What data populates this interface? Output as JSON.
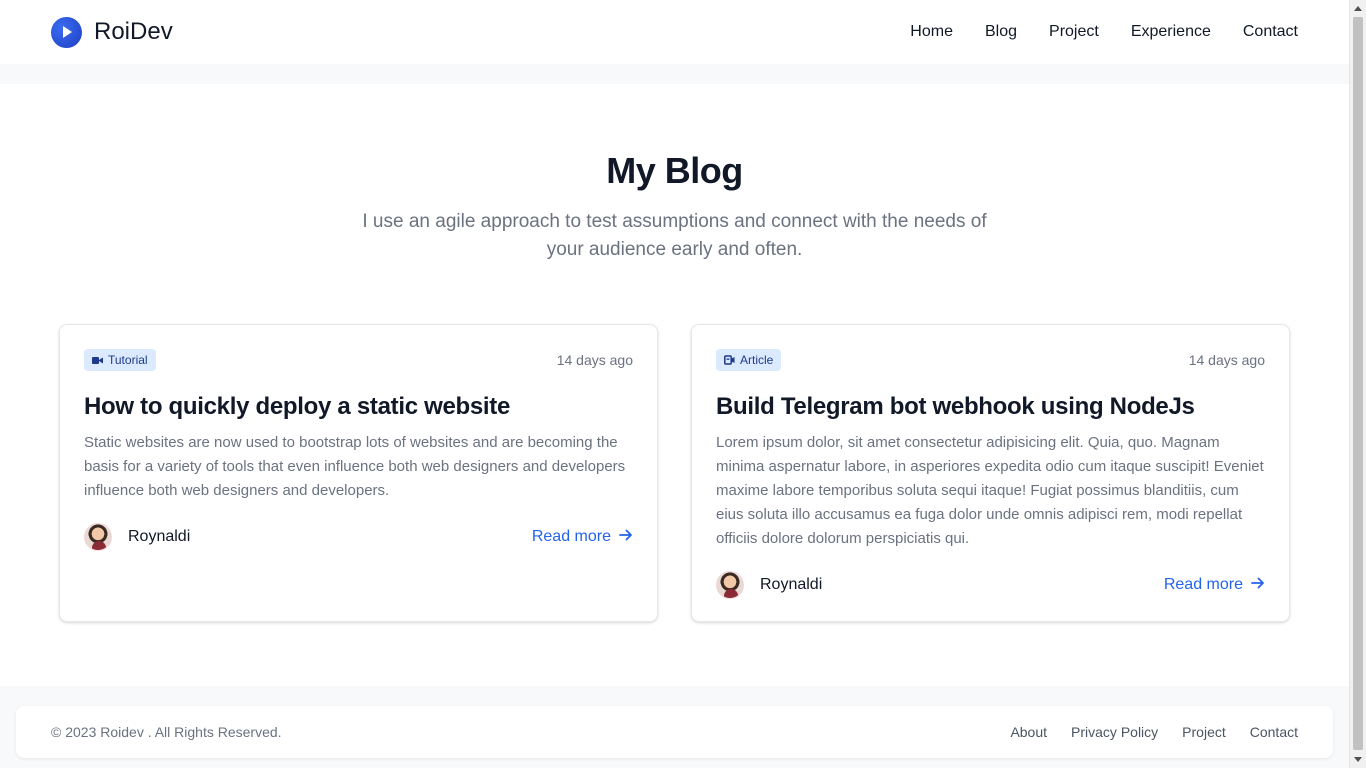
{
  "header": {
    "brand": "RoiDev",
    "nav": [
      "Home",
      "Blog",
      "Project",
      "Experience",
      "Contact"
    ]
  },
  "hero": {
    "title": "My Blog",
    "subtitle": "I use an agile approach to test assumptions and connect with the needs of your audience early and often."
  },
  "posts": [
    {
      "tag": "Tutorial",
      "tag_icon": "video-camera-icon",
      "date": "14 days ago",
      "title": "How to quickly deploy a static website",
      "excerpt": "Static websites are now used to bootstrap lots of websites and are becoming the basis for a variety of tools that even influence both web designers and developers influence both web designers and developers.",
      "author": "Roynaldi",
      "read_more": "Read more"
    },
    {
      "tag": "Article",
      "tag_icon": "article-icon",
      "date": "14 days ago",
      "title": "Build Telegram bot webhook using NodeJs",
      "excerpt": "Lorem ipsum dolor, sit amet consectetur adipisicing elit. Quia, quo. Magnam minima aspernatur labore, in asperiores expedita odio cum itaque suscipit! Eveniet maxime labore temporibus soluta sequi itaque! Fugiat possimus blanditiis, cum eius soluta illo accusamus ea fuga dolor unde omnis adipisci rem, modi repellat officiis dolore dolorum perspiciatis qui.",
      "author": "Roynaldi",
      "read_more": "Read more"
    }
  ],
  "footer": {
    "copyright": "© 2023 Roidev . All Rights Reserved.",
    "links": [
      "About",
      "Privacy Policy",
      "Project",
      "Contact"
    ]
  },
  "colors": {
    "accent": "#2563eb",
    "tag_bg": "#dbeafe",
    "tag_text": "#1e3a8a",
    "muted_text": "#6b7280"
  }
}
